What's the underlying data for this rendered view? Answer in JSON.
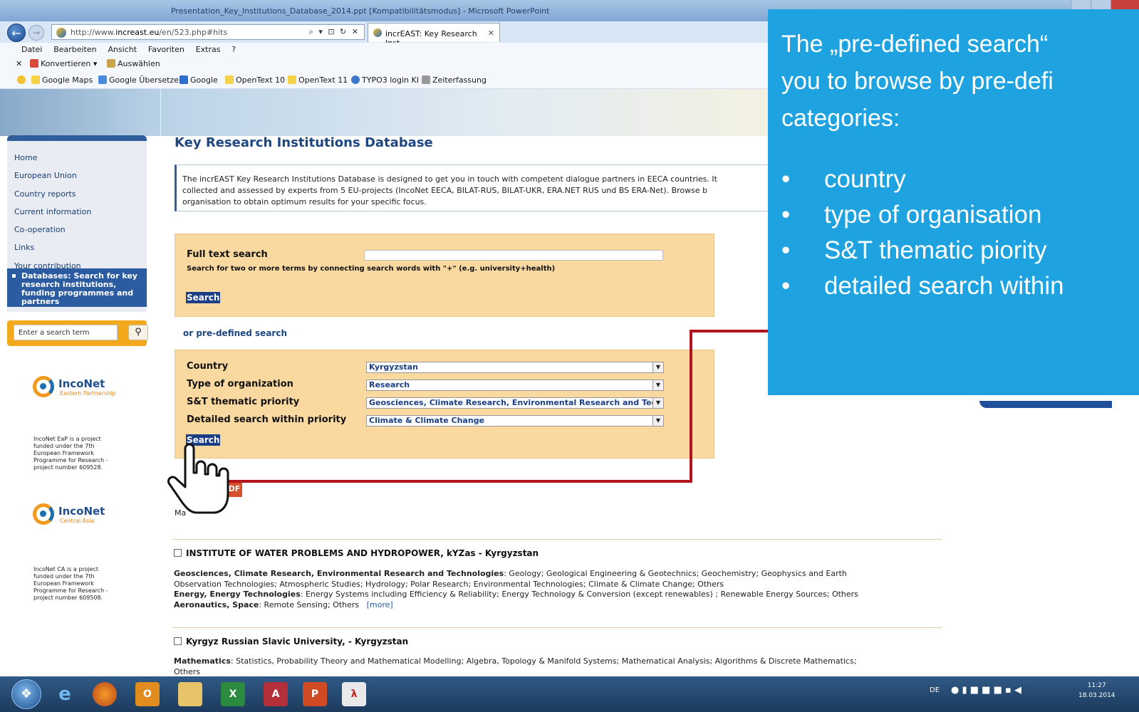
{
  "browser": {
    "window_title": "Presentation_Key_Institutions_Database_2014.ppt [Kompatibilitätsmodus] - Microsoft PowerPoint",
    "url_prefix": "http://www.",
    "url_host": "increast.eu",
    "url_path": "/en/523.php#hits",
    "url_controls": "⌕ ▾ ⊡ ↻ ✕",
    "tab_title": "incrEAST: Key Research Inst...",
    "menu": [
      "Datei",
      "Bearbeiten",
      "Ansicht",
      "Favoriten",
      "Extras",
      "?"
    ],
    "commandbar": {
      "close": "✕",
      "convert": "Konvertieren",
      "convert_arrow": "▾",
      "select": "Auswählen"
    },
    "favorites": [
      "Google Maps",
      "Google Übersetzer",
      "Google",
      "OpenText 10",
      "OpenText 11",
      "TYPO3 login KI",
      "Zeiterfassung"
    ]
  },
  "sidebar": {
    "items": [
      "Home",
      "European Union",
      "Country reports",
      "Current information",
      "Co-operation",
      "Links",
      "Your contribution"
    ],
    "active_item": "Databases: Search for key research institutions, funding programmes and partners",
    "search_placeholder": "Enter a search term",
    "logos": [
      {
        "name": "IncoNet",
        "sub": "Eastern Partnership",
        "text": "IncoNet EaP is a project funded under the 7th European Framework Programme for Research - project number 609528."
      },
      {
        "name": "IncoNet",
        "sub": "Central Asia",
        "text": "IncoNet CA is a project funded under the 7th European Framework Programme for Research - project number 609508."
      }
    ]
  },
  "main": {
    "title": "Key Research Institutions Database",
    "intro_line1": "The incrEAST Key Research Institutions Database is designed to get you in touch with competent dialogue partners in EECA countries. It",
    "intro_line2": "collected and assessed by experts from 5 EU-projects (IncoNet EECA, BILAT-RUS, BILAT-UKR, ERA.NET RUS und BS ERA-Net). Browse b",
    "intro_line3": "organisation to obtain optimum results for your specific focus.",
    "fulltext": {
      "label": "Full text search",
      "hint": "Search for two or more terms by connecting search words with \"+\" (e.g. university+health)",
      "value": "",
      "button": "Search"
    },
    "predefined": {
      "title": "or pre-defined search",
      "fields": [
        {
          "label": "Country",
          "value": "Kyrgyzstan"
        },
        {
          "label": "Type of organization",
          "value": "Research"
        },
        {
          "label": "S&T thematic priority",
          "value": "Geosciences, Climate Research, Environmental Research and Techn"
        },
        {
          "label": "Detailed search within priority",
          "value": "Climate & Climate Change"
        }
      ],
      "button": "Search",
      "select_arrow": "▼"
    },
    "pdf_label": "DF",
    "results_label": "Ma",
    "results": [
      {
        "title": "INSTITUTE OF WATER PROBLEMS AND HYDROPOWER, kYZas - Kyrgyzstan",
        "lines": [
          {
            "head": "Geosciences, Climate Research, Environmental Research and Technologies",
            "text": ": Geology; Geological Engineering & Geotechnics; Geochemistry; Geophysics and Earth"
          },
          {
            "head": "",
            "text": "Observation Technologies; Atmospheric Studies; Hydrology; Polar Research; Environmental Technologies; Climate & Climate Change; Others"
          },
          {
            "head": "Energy, Energy Technologies",
            "text": ": Energy Systems including Efficiency & Reliability; Energy Technology & Conversion (except renewables) ; Renewable Energy Sources; Others"
          },
          {
            "head": "Aeronautics, Space",
            "text": ": Remote Sensing; Others"
          }
        ],
        "more": "[more]"
      },
      {
        "title": "Kyrgyz Russian Slavic University, - Kyrgyzstan",
        "lines": [
          {
            "head": "Mathematics",
            "text": ": Statistics, Probability Theory and Mathematical Modelling; Algebra, Topology & Manifold Systems; Mathematical Analysis; Algorithms & Discrete Mathematics;"
          },
          {
            "head": "",
            "text": "Others"
          }
        ]
      }
    ]
  },
  "overlay": {
    "lines": [
      "The „pre-defined search“",
      "you to browse by pre-defi",
      "categories:"
    ],
    "bullets": [
      "country",
      "type of organisation",
      "S&T thematic piority",
      "detailed search within"
    ],
    "color": "#1ea3e0"
  },
  "annotation": {
    "arrow_color": "#b3151f",
    "icon": "hand-pointer-cursor-icon"
  },
  "taskbar": {
    "apps": [
      "ie-icon",
      "firefox-icon",
      "outlook-icon",
      "explorer-icon",
      "excel-icon",
      "access-icon",
      "powerpoint-icon",
      "acrobat-icon"
    ],
    "tray_lang": "DE",
    "time": "11:27",
    "date": "18.03.2014"
  }
}
